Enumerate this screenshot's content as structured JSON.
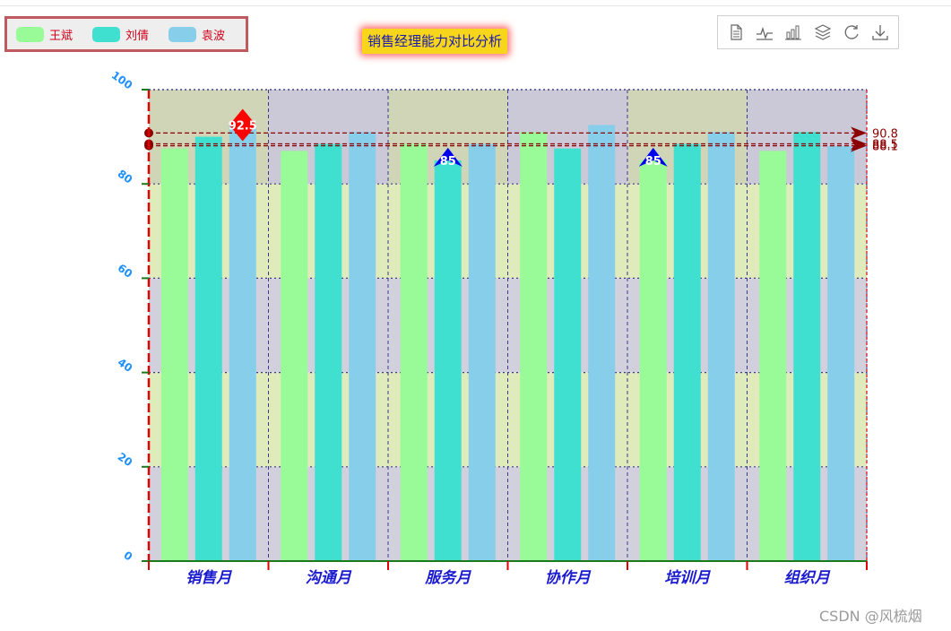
{
  "legend": {
    "items": [
      {
        "label": "王斌",
        "color": "#98fb98"
      },
      {
        "label": "刘倩",
        "color": "#40e0d0"
      },
      {
        "label": "袁波",
        "color": "#87ceeb"
      }
    ]
  },
  "title": "销售经理能力对比分析",
  "toolbox": {
    "icons": [
      "data-view-icon",
      "line-chart-icon",
      "bar-chart-icon",
      "stack-icon",
      "restore-icon",
      "download-icon"
    ]
  },
  "watermark": "CSDN @风梳烟",
  "colors": {
    "axis_y": "#1e90ff",
    "axis_x_label": "#1a1ad0",
    "axis_line": "#e00000",
    "grid": "#3a3a8a",
    "band_top": "#cfd5b6",
    "band_alt": "#cbc8d8",
    "band_yellow": "#dbe8b0",
    "markline": "#8b0000"
  },
  "chart_data": {
    "type": "bar",
    "categories": [
      "销售月",
      "沟通月",
      "服务月",
      "协作月",
      "培训月",
      "组织月"
    ],
    "ylim": [
      0,
      100
    ],
    "yticks": [
      "0",
      "20",
      "40",
      "60",
      "80",
      "100"
    ],
    "series": [
      {
        "name": "王斌",
        "values": [
          87.5,
          87,
          88.5,
          91,
          85,
          87
        ]
      },
      {
        "name": "刘倩",
        "values": [
          90,
          88.5,
          85,
          87.5,
          88.5,
          91
        ]
      },
      {
        "name": "袁波",
        "values": [
          92.5,
          91,
          88.5,
          92.5,
          91,
          88
        ]
      }
    ],
    "mark_points": [
      {
        "series": "袁波",
        "category": "销售月",
        "value": 92.5,
        "label": "92.5",
        "shape": "diamond",
        "color": "#ff0000"
      },
      {
        "series": "刘倩",
        "category": "服务月",
        "value": 85,
        "label": "85",
        "shape": "pin",
        "color": "#0000ee"
      },
      {
        "series": "王斌",
        "category": "培训月",
        "value": 85,
        "label": "85",
        "shape": "pin",
        "color": "#0000ee"
      }
    ],
    "mark_lines": [
      {
        "value": 90.8,
        "label": "90.8"
      },
      {
        "value": 88.5,
        "label": "88.5"
      },
      {
        "value": 88.1,
        "label": "88.1"
      }
    ]
  }
}
